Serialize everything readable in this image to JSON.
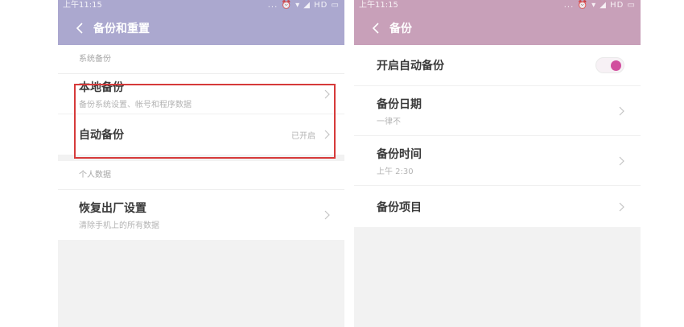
{
  "colors": {
    "left_titlebar": "#aba8cf",
    "right_titlebar": "#c8a0b9",
    "toggle_on": "#d14f9e",
    "highlight": "#d63a3a"
  },
  "left": {
    "status": {
      "time": "上午11:15",
      "indicators": "... ⏰ ▾ ◢ HD ▭"
    },
    "title": "备份和重置",
    "sections": [
      {
        "header": "系统备份",
        "items": [
          {
            "title": "本地备份",
            "subtitle": "备份系统设置、帐号和程序数据"
          },
          {
            "title": "自动备份",
            "value": "已开启"
          }
        ]
      },
      {
        "header": "个人数据",
        "items": [
          {
            "title": "恢复出厂设置",
            "subtitle": "清除手机上的所有数据"
          }
        ]
      }
    ]
  },
  "right": {
    "status": {
      "time": "上午11:15",
      "indicators": "... ⏰ ▾ ◢ HD ▭"
    },
    "title": "备份",
    "items": [
      {
        "title": "开启自动备份",
        "toggle_on": true
      },
      {
        "title": "备份日期",
        "subtitle": "一律不"
      },
      {
        "title": "备份时间",
        "subtitle": "上午 2:30"
      },
      {
        "title": "备份项目"
      }
    ]
  }
}
